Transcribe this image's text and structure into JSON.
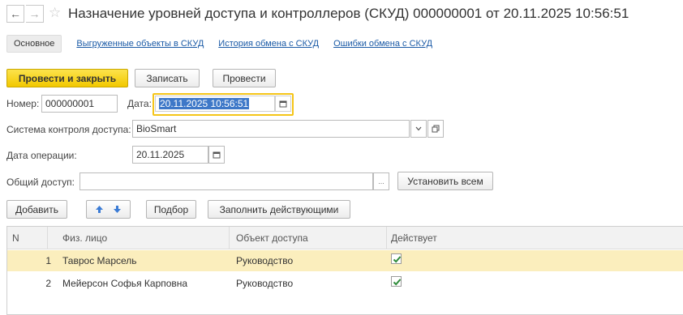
{
  "window": {
    "title": "Назначение уровней доступа и контроллеров (СКУД) 000000001 от 20.11.2025 10:56:51"
  },
  "nav": {
    "back_glyph": "←",
    "forward_glyph": "→",
    "star_glyph": "☆"
  },
  "tabs": [
    {
      "label": "Основное"
    },
    {
      "label": "Выгруженные объекты в СКУД"
    },
    {
      "label": "История обмена с СКУД"
    },
    {
      "label": "Ошибки обмена с СКУД"
    }
  ],
  "toolbar": {
    "post_close_label": "Провести и закрыть",
    "save_label": "Записать",
    "post_label": "Провести"
  },
  "form": {
    "number_label": "Номер:",
    "number_value": "000000001",
    "date_label": "Дата:",
    "date_value": "20.11.2025 10:56:51",
    "system_label": "Система контроля доступа:",
    "system_value": "BioSmart",
    "operation_date_label": "Дата операции:",
    "operation_date_value": "20.11.2025",
    "common_access_label": "Общий доступ:",
    "common_access_value": "",
    "set_all_label": "Установить всем",
    "ellipsis": "..."
  },
  "table_toolbar": {
    "add_label": "Добавить",
    "pick_label": "Подбор",
    "fill_active_label": "Заполнить действующими"
  },
  "table": {
    "columns": [
      "N",
      "Физ. лицо",
      "Объект доступа",
      "Действует"
    ],
    "rows": [
      {
        "n": "1",
        "person": "Таврос Марсель",
        "object": "Руководство",
        "active": true,
        "selected": true
      },
      {
        "n": "2",
        "person": "Мейерсон Софья Карповна",
        "object": "Руководство",
        "active": true,
        "selected": false
      }
    ]
  },
  "colors": {
    "accent": "#f2c800",
    "link": "#1a5aa6",
    "selection": "#fbeebd",
    "check": "#2e8b3a"
  }
}
